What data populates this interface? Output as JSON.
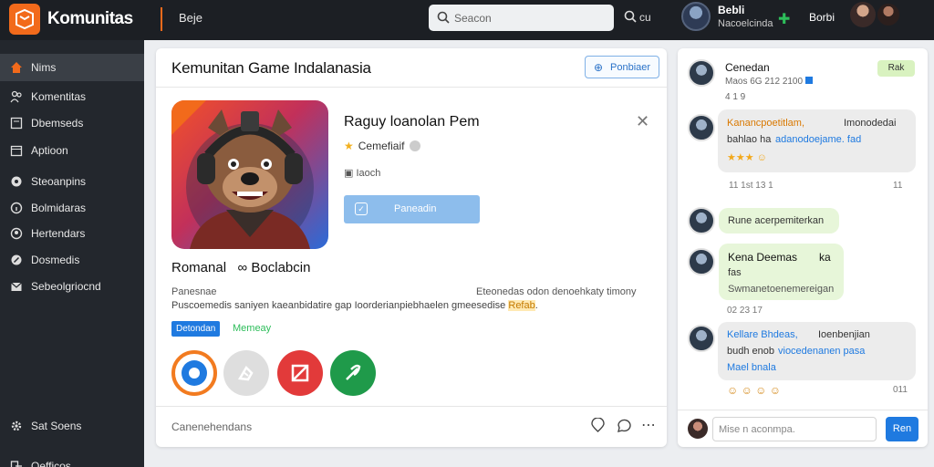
{
  "app": {
    "brand": "Komunitas",
    "page_label": "Beje",
    "search_placeholder": "Seacon",
    "search2_label": "cu",
    "user_name": "Bebli",
    "user_sub": "Nacoelcinda",
    "right_label": "Borbi"
  },
  "sidebar": {
    "items": [
      {
        "label": "Nims",
        "icon": "home-icon",
        "active": true
      },
      {
        "label": "Komentitas",
        "icon": "community-icon"
      },
      {
        "label": "Dbemseds",
        "icon": "document-icon"
      },
      {
        "label": "Aptioon",
        "icon": "calendar-icon"
      },
      {
        "label": "Steoanpins",
        "icon": "settings-circle-icon"
      },
      {
        "label": "Bolmidaras",
        "icon": "info-icon"
      },
      {
        "label": "Hertendars",
        "icon": "people-icon"
      },
      {
        "label": "Dosmedis",
        "icon": "edit-icon"
      },
      {
        "label": "Sebeolgriocnd",
        "icon": "mail-icon"
      }
    ],
    "bottom_items": [
      {
        "label": "Sat Soens",
        "icon": "gear-icon"
      },
      {
        "label": "Oefficos",
        "icon": "logout-icon"
      }
    ]
  },
  "main": {
    "title": "Kemunitan Game Indalanasia",
    "follow_label": "Ponbiaer",
    "game_title": "Raguy loanolan Pem",
    "game_meta": "Cemefiaif",
    "game_sub": "Iaoch",
    "join_label": "Paneadin",
    "developer": "Romanal",
    "developer_suffix": "Boclabcin",
    "desc_left": "Panesnae",
    "desc_right": "Eteonedas odon denoehkaty timony",
    "desc_line2": "Puscoemedis saniyen kaeanbidatire gap  Ioorderianpiebhaelen gmeesedise",
    "desc_highlight": "Refab",
    "tag_primary": "Detondan",
    "tag_secondary": "Memeay",
    "footer_label": "Canenehendans"
  },
  "chat": {
    "header": {
      "name": "Cenedan",
      "sub": "Maos 6G 212 2100",
      "meta": "4 1 9",
      "badge": "Rak"
    },
    "messages": [
      {
        "l1": "Kanancpoetitlam,",
        "l1b": "Imonodedai",
        "l2a": "bahlao ha",
        "l2b": "adanodoejame. fad",
        "time": "11 1st 13 1",
        "time_right": "11"
      },
      {
        "l1": "Rune acerpemiterkan"
      },
      {
        "l1": "Kena Deemas",
        "l1b": "ka",
        "l2": "fas",
        "l3": "Swmanetoenemereigan",
        "time": "02 23 17"
      },
      {
        "l1": "Kellare Bhdeas,",
        "l1b": "Ioenbenjian",
        "l2a": "budh enob",
        "l2b": "viocedenanen pasa",
        "l3": "Mael bnala",
        "time_right": "011"
      }
    ],
    "input_placeholder": "Mise n aconmpa.",
    "send_label": "Ren"
  },
  "colors": {
    "accent_orange": "#f26a1b",
    "link_blue": "#1f7ae0",
    "green": "#2dbd5a",
    "sidebar_bg": "#23272d",
    "topbar_bg": "#1c1f24"
  }
}
